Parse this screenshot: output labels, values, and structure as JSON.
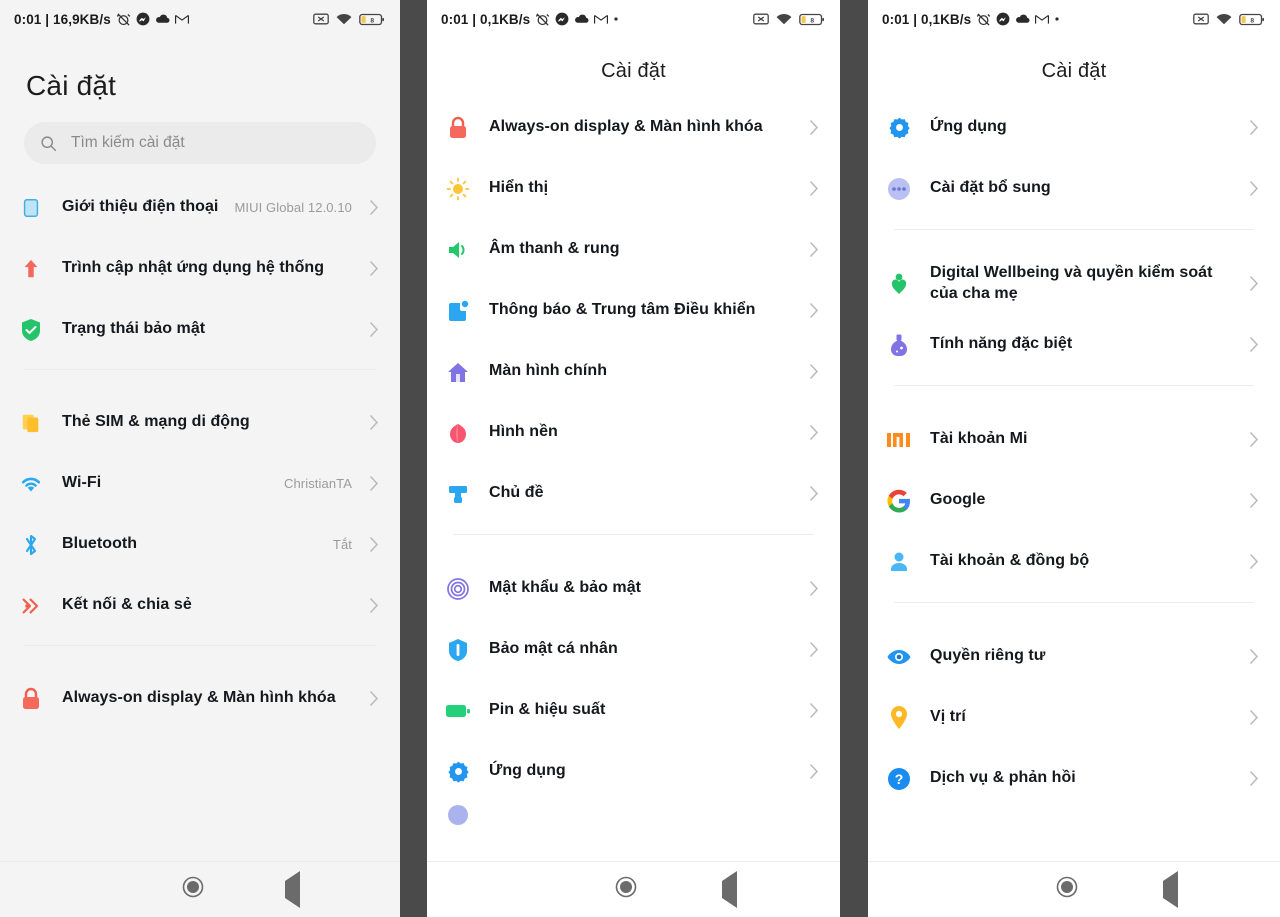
{
  "statusbar": {
    "clock_panel1": "0:01 | 16,9KB/s",
    "clock_panel2": "0:01 | 0,1KB/s",
    "clock_panel3": "0:01 | 0,1KB/s",
    "battery_level": "8",
    "icons_left": [
      "alarm-off-icon",
      "messenger-icon",
      "cloud-icon",
      "gmail-icon"
    ],
    "icons_right": [
      "no-sim-icon",
      "wifi-icon",
      "battery-icon"
    ]
  },
  "panel1": {
    "title": "Cài đặt",
    "search": {
      "placeholder": "Tìm kiếm cài đặt",
      "icon": "search-icon"
    },
    "groups": [
      {
        "items": [
          {
            "label": "Giới thiệu điện thoại",
            "value": "MIUI Global 12.0.10",
            "icon": "phone-info-icon"
          },
          {
            "label": "Trình cập nhật ứng dụng hệ thống",
            "value": "",
            "icon": "system-update-icon"
          },
          {
            "label": "Trạng thái bảo mật",
            "value": "",
            "icon": "security-status-icon"
          }
        ]
      },
      {
        "items": [
          {
            "label": "Thẻ SIM & mạng di động",
            "value": "",
            "icon": "sim-card-icon"
          },
          {
            "label": "Wi-Fi",
            "value": "ChristianTA",
            "icon": "wifi-icon"
          },
          {
            "label": "Bluetooth",
            "value": "Tắt",
            "icon": "bluetooth-icon"
          },
          {
            "label": "Kết nối & chia sẻ",
            "value": "",
            "icon": "connection-share-icon"
          }
        ]
      },
      {
        "items": [
          {
            "label": "Always-on display & Màn hình khóa",
            "value": "",
            "icon": "lock-icon"
          }
        ]
      }
    ]
  },
  "panel2": {
    "title": "Cài đặt",
    "groups": [
      {
        "items": [
          {
            "label": "Always-on display & Màn hình khóa",
            "icon": "lock-icon"
          },
          {
            "label": "Hiển thị",
            "icon": "display-icon"
          },
          {
            "label": "Âm thanh & rung",
            "icon": "sound-icon"
          },
          {
            "label": "Thông báo & Trung tâm Điều khiển",
            "icon": "notification-icon"
          },
          {
            "label": "Màn hình chính",
            "icon": "home-screen-icon"
          },
          {
            "label": "Hình nền",
            "icon": "wallpaper-icon"
          },
          {
            "label": "Chủ đề",
            "icon": "theme-icon"
          }
        ]
      },
      {
        "items": [
          {
            "label": "Mật khẩu & bảo mật",
            "icon": "fingerprint-icon"
          },
          {
            "label": "Bảo mật cá nhân",
            "icon": "personal-security-icon"
          },
          {
            "label": "Pin & hiệu suất",
            "icon": "battery-icon"
          },
          {
            "label": "Ứng dụng",
            "icon": "apps-icon"
          }
        ]
      }
    ]
  },
  "panel3": {
    "title": "Cài đặt",
    "groups": [
      {
        "items": [
          {
            "label": "Ứng dụng",
            "icon": "apps-icon"
          },
          {
            "label": "Cài đặt bổ sung",
            "icon": "additional-settings-icon"
          }
        ]
      },
      {
        "items": [
          {
            "label": "Digital Wellbeing và quyền kiểm soát của cha mẹ",
            "icon": "digital-wellbeing-icon"
          },
          {
            "label": "Tính năng đặc biệt",
            "icon": "special-features-icon"
          }
        ]
      },
      {
        "items": [
          {
            "label": "Tài khoản Mi",
            "icon": "mi-account-icon"
          },
          {
            "label": "Google",
            "icon": "google-icon"
          },
          {
            "label": "Tài khoản & đồng bộ",
            "icon": "accounts-sync-icon"
          }
        ]
      },
      {
        "items": [
          {
            "label": "Quyền riêng tư",
            "icon": "privacy-eye-icon"
          },
          {
            "label": "Vị trí",
            "icon": "location-pin-icon"
          },
          {
            "label": "Dịch vụ & phản hồi",
            "icon": "services-feedback-icon"
          }
        ]
      }
    ]
  },
  "navbar": {
    "recents": "recents-square-icon",
    "home": "home-circle-icon",
    "back": "back-triangle-icon"
  },
  "colors": {
    "divider_bg": "#4a4a4a",
    "panel1_bg": "#f4f4f4",
    "label": "#15181c",
    "value": "#9b9b9b"
  }
}
